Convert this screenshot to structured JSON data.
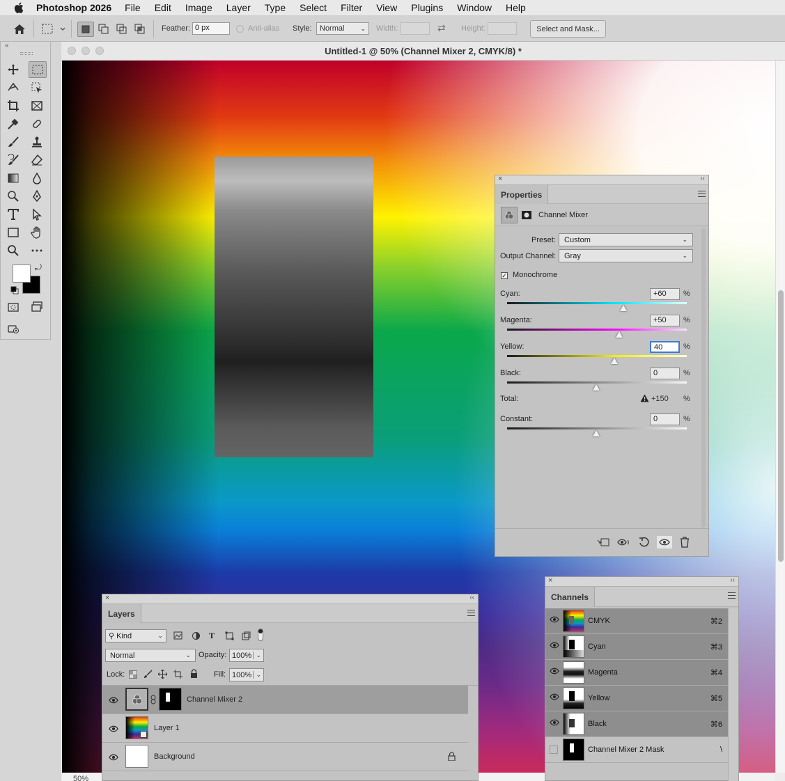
{
  "menubar": {
    "app_name": "Photoshop 2026",
    "items": [
      "File",
      "Edit",
      "Image",
      "Layer",
      "Type",
      "Select",
      "Filter",
      "View",
      "Plugins",
      "Window",
      "Help"
    ]
  },
  "options_bar": {
    "feather_label": "Feather:",
    "feather_value": "0 px",
    "antialias_label": "Anti-alias",
    "style_label": "Style:",
    "style_value": "Normal",
    "width_label": "Width:",
    "height_label": "Height:",
    "select_mask_label": "Select and Mask..."
  },
  "document": {
    "title": "Untitled-1 @ 50% (Channel Mixer 2, CMYK/8) *",
    "zoom": "50%"
  },
  "properties": {
    "tab": "Properties",
    "adjustment_name": "Channel Mixer",
    "preset_label": "Preset:",
    "preset_value": "Custom",
    "output_label": "Output Channel:",
    "output_value": "Gray",
    "monochrome_label": "Monochrome",
    "monochrome_checked": true,
    "cyan_label": "Cyan:",
    "cyan_value": "+60",
    "magenta_label": "Magenta:",
    "magenta_value": "+50",
    "yellow_label": "Yellow:",
    "yellow_value": "40",
    "black_label": "Black:",
    "black_value": "0",
    "total_label": "Total:",
    "total_value": "+150",
    "constant_label": "Constant:",
    "constant_value": "0",
    "pct": "%"
  },
  "layers": {
    "tab": "Layers",
    "kind_label": "Kind",
    "blend_mode": "Normal",
    "opacity_label": "Opacity:",
    "opacity_value": "100%",
    "lock_label": "Lock:",
    "fill_label": "Fill:",
    "fill_value": "100%",
    "rows": [
      {
        "name": "Channel Mixer 2"
      },
      {
        "name": "Layer 1"
      },
      {
        "name": "Background"
      }
    ]
  },
  "channels": {
    "tab": "Channels",
    "rows": [
      {
        "name": "CMYK",
        "shortcut": "⌘2"
      },
      {
        "name": "Cyan",
        "shortcut": "⌘3"
      },
      {
        "name": "Magenta",
        "shortcut": "⌘4"
      },
      {
        "name": "Yellow",
        "shortcut": "⌘5"
      },
      {
        "name": "Black",
        "shortcut": "⌘6"
      },
      {
        "name": "Channel Mixer 2 Mask",
        "shortcut": "\\"
      }
    ]
  },
  "colors": {
    "accent": "#3b7ad9",
    "panel_bg": "#c3c3c3",
    "selected_row": "#8e8e8e"
  }
}
